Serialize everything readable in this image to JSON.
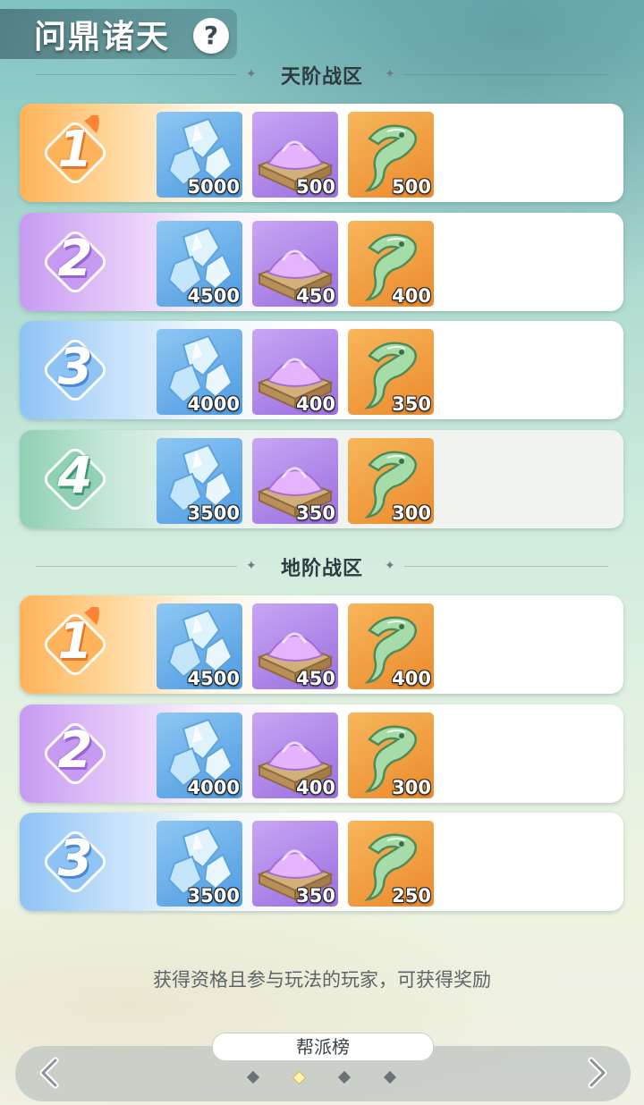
{
  "header": {
    "title": "问鼎诸天",
    "help_label": "?"
  },
  "sections": [
    {
      "title": "天阶战区",
      "ranks": [
        {
          "rank": "1",
          "rewards": [
            "5000",
            "500",
            "500"
          ]
        },
        {
          "rank": "2",
          "rewards": [
            "4500",
            "450",
            "400"
          ]
        },
        {
          "rank": "3",
          "rewards": [
            "4000",
            "400",
            "350"
          ]
        },
        {
          "rank": "4",
          "rewards": [
            "3500",
            "350",
            "300"
          ]
        }
      ]
    },
    {
      "title": "地阶战区",
      "ranks": [
        {
          "rank": "1",
          "rewards": [
            "4500",
            "450",
            "400"
          ]
        },
        {
          "rank": "2",
          "rewards": [
            "4000",
            "400",
            "300"
          ]
        },
        {
          "rank": "3",
          "rewards": [
            "3500",
            "350",
            "250"
          ]
        }
      ]
    }
  ],
  "reward_icons": [
    "crystal-icon",
    "spirit-sand-icon",
    "jade-claw-icon"
  ],
  "footer": {
    "note": "获得资格且参与玩法的玩家，可获得奖励"
  },
  "bottom_nav": {
    "tab_label": "帮派榜",
    "page_count": 4,
    "active_page": 2
  },
  "colors": {
    "rank1": "#ffb35a",
    "rank2": "#c79af2",
    "rank3": "#8dc3f5",
    "rank4": "#8fd0b3"
  }
}
